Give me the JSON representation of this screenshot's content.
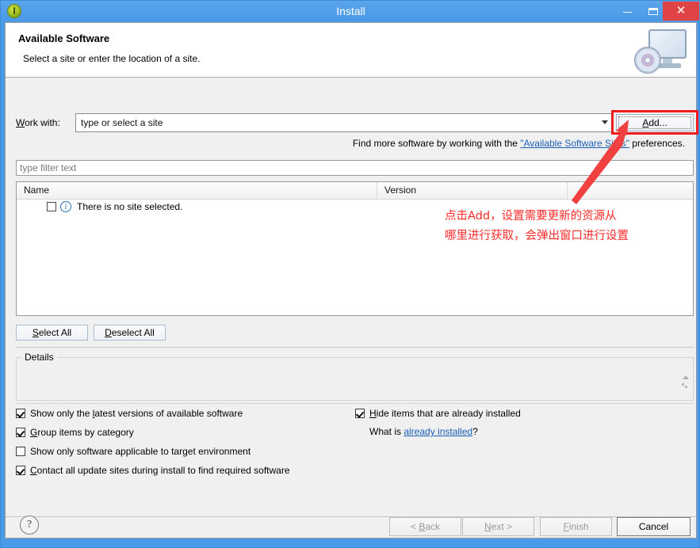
{
  "window": {
    "title": "Install",
    "icon": "eclipse-icon",
    "controls": {
      "minimize": "–",
      "maximize": "□",
      "close": "✕"
    }
  },
  "header": {
    "title": "Available Software",
    "subtitle": "Select a site or enter the location of a site.",
    "icon": "monitor-cd-icon"
  },
  "work_with": {
    "label": "Work with:",
    "value": "",
    "placeholder": "type or select a site",
    "add_button": "Add..."
  },
  "find_more": {
    "prefix": "Find more software by working with the ",
    "link": "\"Available Software Sites\"",
    "suffix": " preferences."
  },
  "filter": {
    "placeholder": "type filter text",
    "value": ""
  },
  "table": {
    "columns": [
      "Name",
      "Version",
      ""
    ],
    "rows": [
      {
        "checked": false,
        "icon": "info-icon",
        "name": "There is no site selected.",
        "version": ""
      }
    ]
  },
  "selection_buttons": {
    "select_all": "Select All",
    "deselect_all": "Deselect All"
  },
  "details": {
    "legend": "Details",
    "content": ""
  },
  "options": {
    "left": [
      {
        "label": "Show only the latest versions of available software",
        "checked": true
      },
      {
        "label": "Group items by category",
        "checked": true
      },
      {
        "label": "Show only software applicable to target environment",
        "checked": false
      },
      {
        "label": "Contact all update sites during install to find required software",
        "checked": true
      }
    ],
    "right": [
      {
        "label": "Hide items that are already installed",
        "checked": true
      }
    ],
    "what_is": {
      "prefix": "What is ",
      "link": "already installed",
      "suffix": "?"
    }
  },
  "footer": {
    "help": "?",
    "buttons": [
      {
        "label": "< Back",
        "enabled": false
      },
      {
        "label": "Next >",
        "enabled": false
      },
      {
        "label": "Finish",
        "enabled": false
      },
      {
        "label": "Cancel",
        "enabled": true
      }
    ]
  },
  "annotation": {
    "text": "点击Add，设置需要更新的资源从\n哪里进行获取，会弹出窗口进行设置",
    "color": "#ff2a2a",
    "highlight_target": "add-button",
    "arrow": {
      "from": [
        720,
        252
      ],
      "to": [
        791,
        152
      ]
    }
  },
  "colors": {
    "window_frame": "#4a9ae8",
    "dialog_bg": "#f0f0f0",
    "link": "#1a5fb4",
    "annotation_red": "#ff2a2a",
    "close_button": "#e04343"
  }
}
